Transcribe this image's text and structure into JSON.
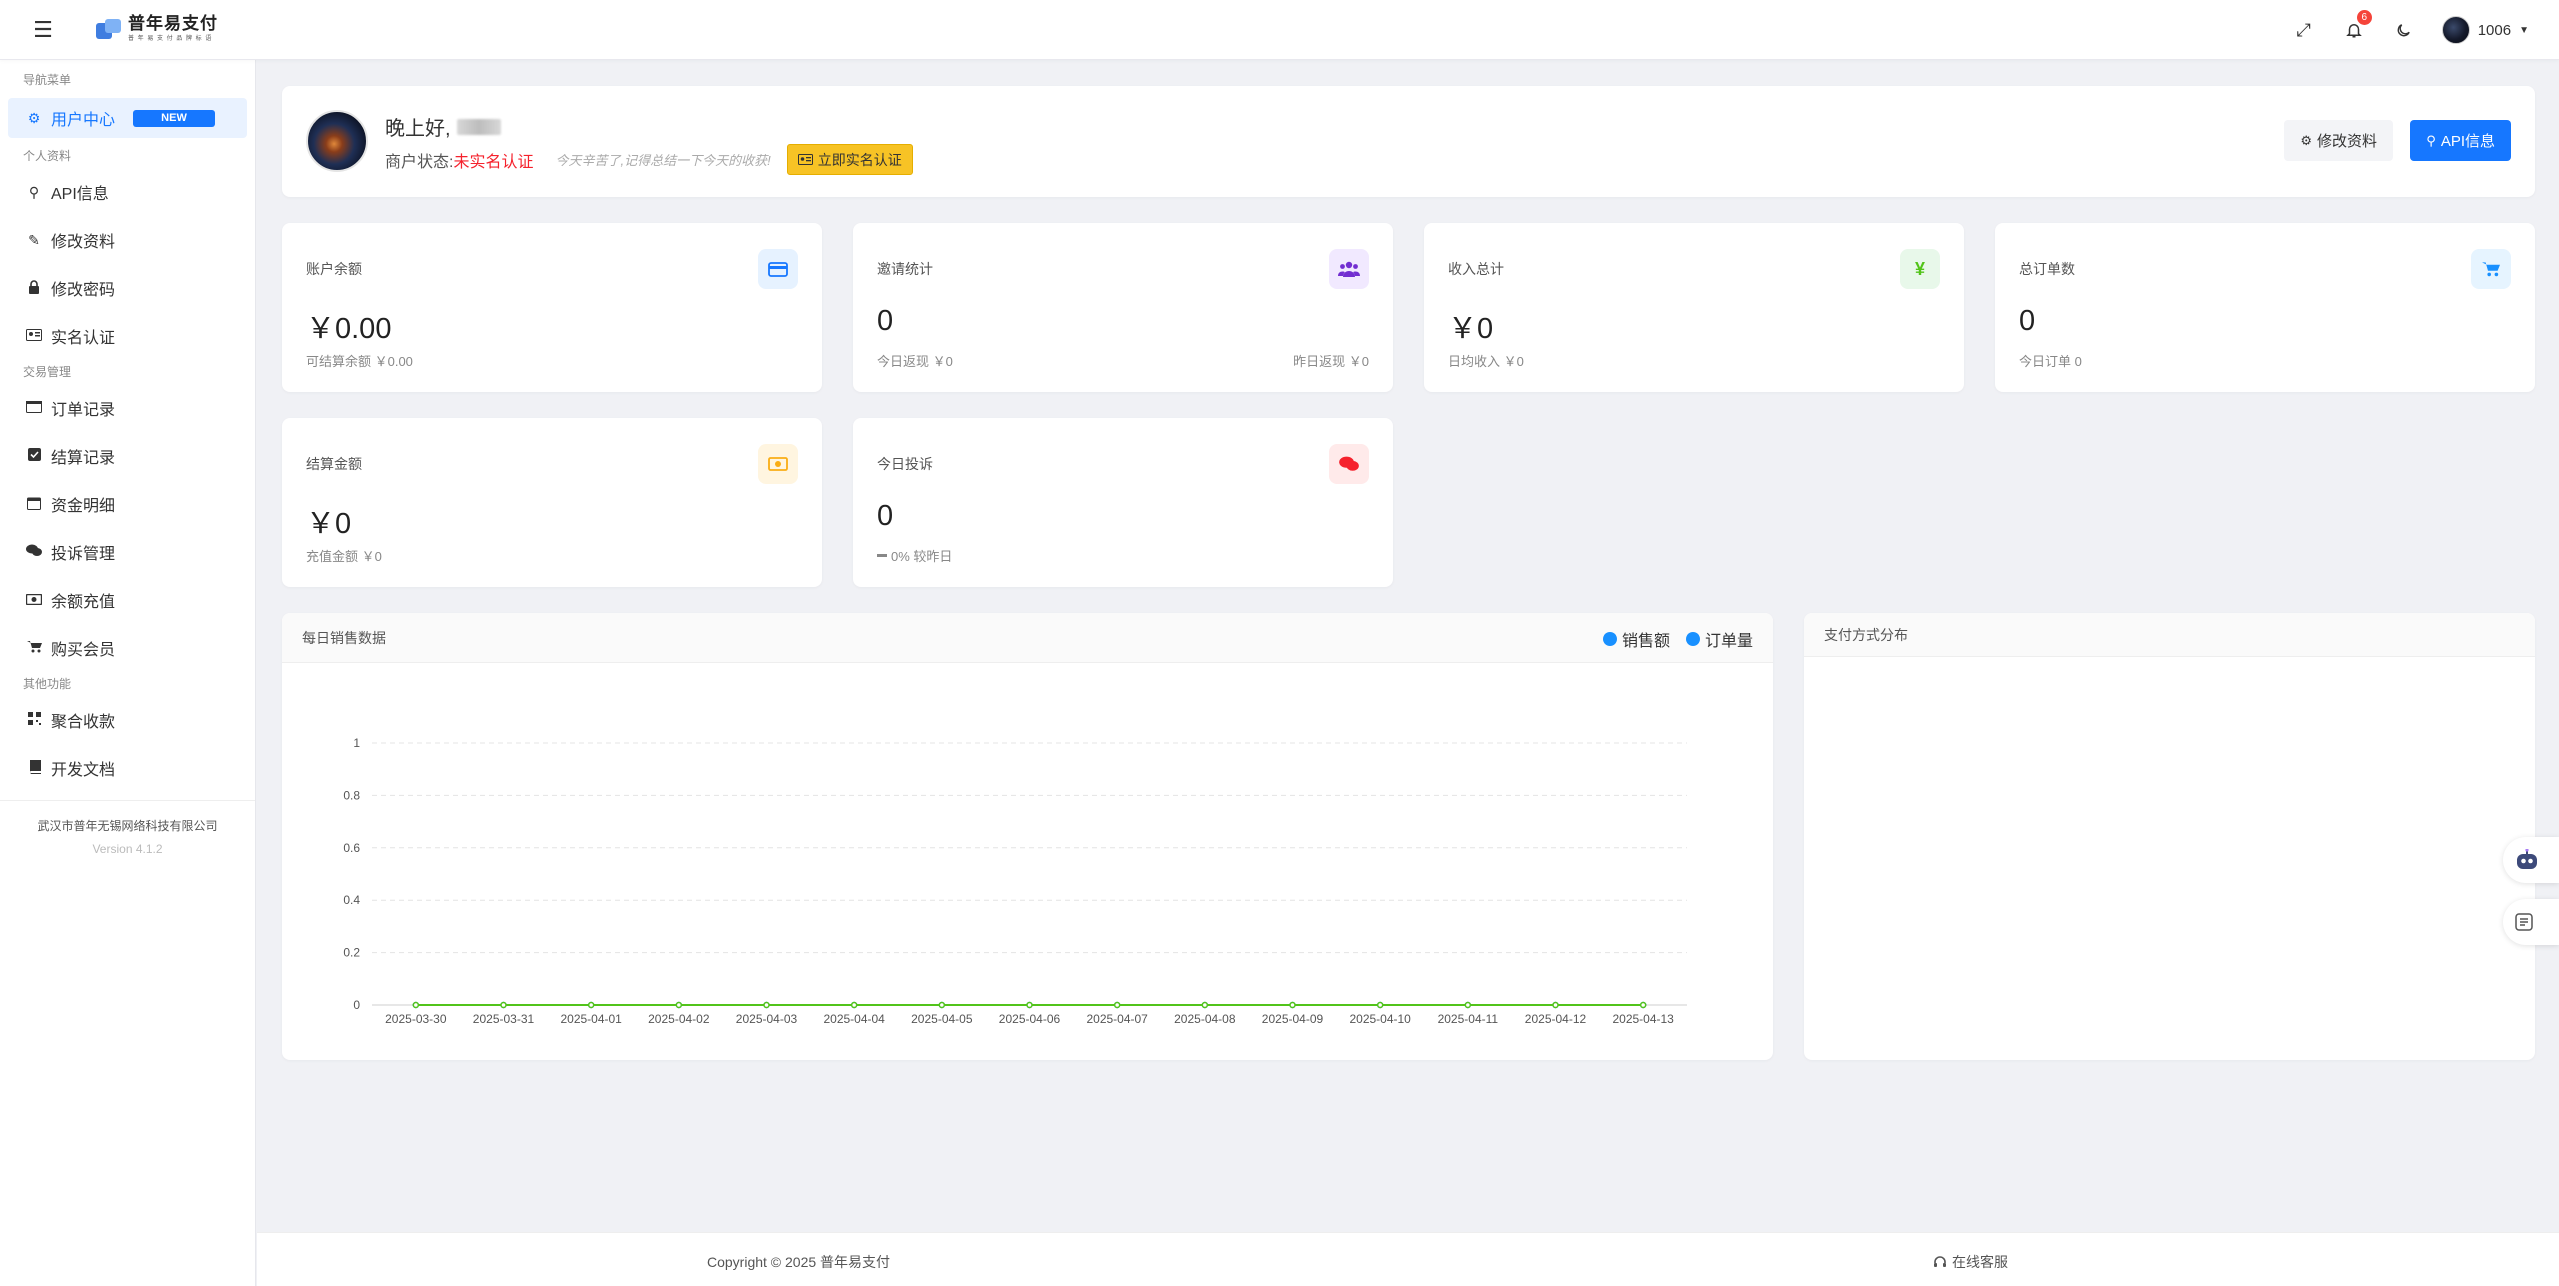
{
  "header": {
    "brand_name": "普年易支付",
    "brand_sub": "普 年 易 支 付 品 牌 标 语",
    "notifications_count": "6",
    "username": "1006"
  },
  "sidebar": {
    "sections": {
      "nav": "导航菜单",
      "profile": "个人资料",
      "trade": "交易管理",
      "other": "其他功能"
    },
    "items": {
      "user_center": "用户中心",
      "new_badge": "NEW",
      "api_info": "API信息",
      "edit_profile": "修改资料",
      "change_password": "修改密码",
      "real_name": "实名认证",
      "orders": "订单记录",
      "settlements": "结算记录",
      "funds": "资金明细",
      "complaints": "投诉管理",
      "recharge": "余额充值",
      "membership": "购买会员",
      "aggregate": "聚合收款",
      "docs": "开发文档"
    },
    "company": "武汉市普年无锡网络科技有限公司",
    "version": "Version 4.1.2"
  },
  "welcome": {
    "greeting": "晚上好,",
    "status_label": "商户状态:",
    "status_value": "未实名认证",
    "tip": "今天辛苦了,记得总结一下今天的收获!",
    "verify_button": "立即实名认证",
    "edit_button": "修改资料",
    "api_button": "API信息"
  },
  "stats": {
    "balance": {
      "label": "账户余额",
      "value": "￥0.00",
      "sub": "可结算余额 ￥0.00"
    },
    "invite": {
      "label": "邀请统计",
      "value": "0",
      "sub": "今日返现 ￥0",
      "sub_right": "昨日返现 ￥0"
    },
    "income": {
      "label": "收入总计",
      "value": "￥0",
      "sub": "日均收入 ￥0"
    },
    "orders": {
      "label": "总订单数",
      "value": "0",
      "sub": "今日订单 0"
    },
    "settle": {
      "label": "结算金额",
      "value": "￥0",
      "sub": "充值金额 ￥0"
    },
    "complaint": {
      "label": "今日投诉",
      "value": "0",
      "sub": "0% 较昨日"
    }
  },
  "sales_panel": {
    "title": "每日销售数据",
    "legend_sales": "销售额",
    "legend_orders": "订单量"
  },
  "payment_panel": {
    "title": "支付方式分布"
  },
  "footer": {
    "copyright": "Copyright © 2025 普年易支付",
    "service": "在线客服"
  },
  "colors": {
    "primary": "#1677ff",
    "sales_line": "#52c41a",
    "danger": "#f5222d"
  },
  "chart_data": {
    "type": "line",
    "title": "每日销售数据",
    "x": [
      "2025-03-30",
      "2025-03-31",
      "2025-04-01",
      "2025-04-02",
      "2025-04-03",
      "2025-04-04",
      "2025-04-05",
      "2025-04-06",
      "2025-04-07",
      "2025-04-08",
      "2025-04-09",
      "2025-04-10",
      "2025-04-11",
      "2025-04-12",
      "2025-04-13"
    ],
    "series": [
      {
        "name": "销售额",
        "values": [
          0,
          0,
          0,
          0,
          0,
          0,
          0,
          0,
          0,
          0,
          0,
          0,
          0,
          0,
          0
        ],
        "color": "#52c41a"
      },
      {
        "name": "订单量",
        "values": [
          0,
          0,
          0,
          0,
          0,
          0,
          0,
          0,
          0,
          0,
          0,
          0,
          0,
          0,
          0
        ],
        "color": "#1677ff"
      }
    ],
    "yticks": [
      "0",
      "0.2",
      "0.4",
      "0.6",
      "0.8",
      "1"
    ],
    "ylim": [
      0,
      1
    ],
    "grid": true,
    "legend": "top-right"
  }
}
